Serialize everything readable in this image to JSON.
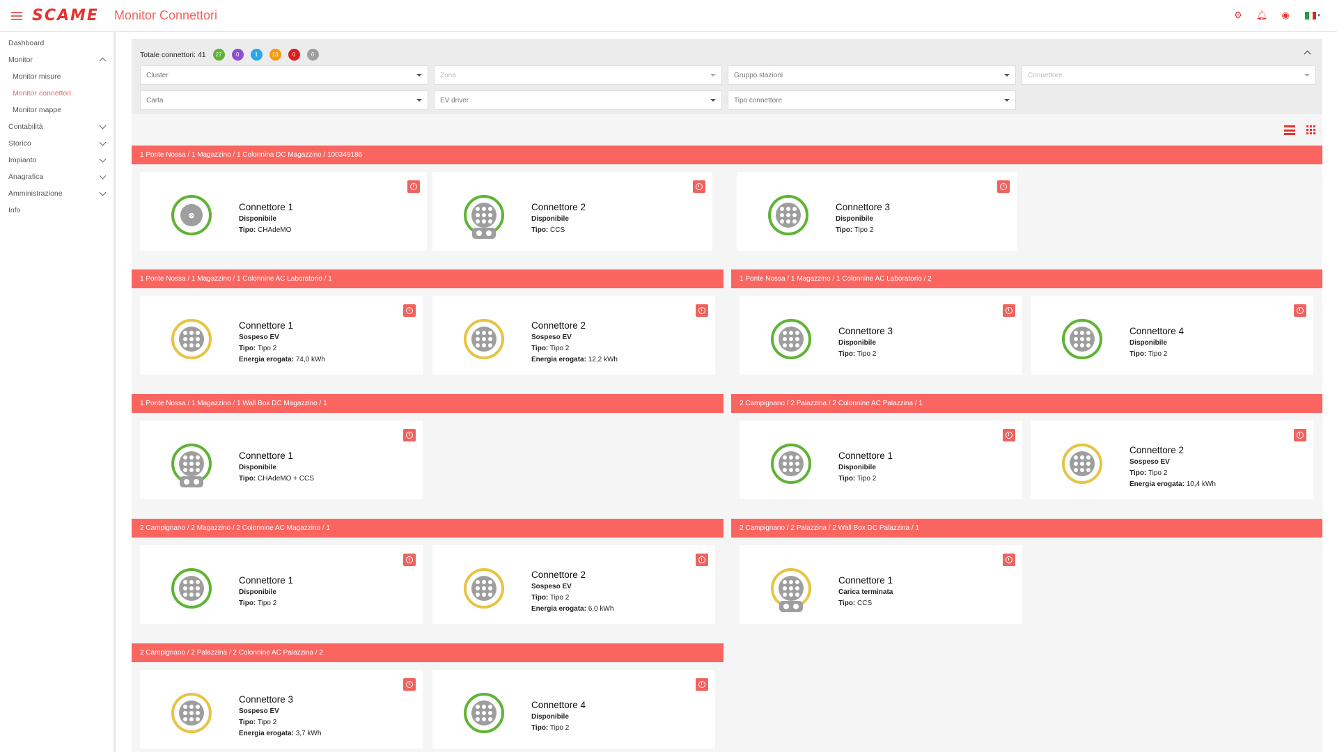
{
  "app": {
    "logo": "SCAME",
    "title": "Monitor Connettori"
  },
  "icons": {
    "settings": "gear-icon",
    "notifications": "bell-icon",
    "account": "user-icon",
    "language": "italy-flag-icon",
    "accent": "#f0625e"
  },
  "sidebar": {
    "items": [
      {
        "label": "Dashboard",
        "type": "item"
      },
      {
        "label": "Monitor",
        "type": "expanded"
      },
      {
        "label": "Monitor misure",
        "type": "sub"
      },
      {
        "label": "Monitor connettori",
        "type": "sub-active"
      },
      {
        "label": "Monitor mappe",
        "type": "sub"
      },
      {
        "label": "Contabilità",
        "type": "collapsed"
      },
      {
        "label": "Storico",
        "type": "collapsed"
      },
      {
        "label": "Impianto",
        "type": "collapsed"
      },
      {
        "label": "Anagrafica",
        "type": "collapsed"
      },
      {
        "label": "Amministrazione",
        "type": "collapsed"
      },
      {
        "label": "Info",
        "type": "item"
      }
    ]
  },
  "filters": {
    "total_label": "Totale connettori: 41",
    "badges": [
      {
        "value": "27",
        "color": "#5fb336"
      },
      {
        "value": "0",
        "color": "#8b4fd1"
      },
      {
        "value": "1",
        "color": "#28a7e8"
      },
      {
        "value": "13",
        "color": "#f39c12"
      },
      {
        "value": "0",
        "color": "#d81e1e"
      },
      {
        "value": "0",
        "color": "#9e9e9e"
      }
    ],
    "cluster": "Cluster",
    "zona": "Zona",
    "gruppo": "Gruppo stazioni",
    "connettore": "Connettore",
    "carta": "Carta",
    "ev_driver": "EV driver",
    "tipo": "Tipo connettore"
  },
  "groups": [
    {
      "title": "1 Ponte Nossa / 1 Magazzino / 1 Colonnina DC Magazzino / 100349186",
      "connectors": [
        {
          "name": "Connettore 1",
          "status": "Disponibile",
          "color": "green",
          "plug": "chademo",
          "tipo": "CHAdeMO"
        },
        {
          "name": "Connettore 2",
          "status": "Disponibile",
          "color": "green",
          "plug": "ccs",
          "tipo": "CCS"
        },
        {
          "name": "Connettore 3",
          "status": "Disponibile",
          "color": "green",
          "plug": "t2",
          "tipo": "Tipo 2"
        }
      ]
    },
    {
      "title": "1 Ponte Nossa / 1 Magazzino / 1 Colonnine AC Laboratorio / 1",
      "connectors": [
        {
          "name": "Connettore 1",
          "status": "Sospeso EV",
          "color": "yellow",
          "plug": "t2",
          "tipo": "Tipo 2",
          "energia": "74,0 kWh"
        },
        {
          "name": "Connettore 2",
          "status": "Sospeso EV",
          "color": "yellow",
          "plug": "t2",
          "tipo": "Tipo 2",
          "energia": "12,2 kWh"
        }
      ]
    },
    {
      "title": "1 Ponte Nossa / 1 Magazzino / 1 Colonnine AC Laboratorio / 2",
      "connectors": [
        {
          "name": "Connettore 3",
          "status": "Disponibile",
          "color": "green",
          "plug": "t2",
          "tipo": "Tipo 2"
        },
        {
          "name": "Connettore 4",
          "status": "Disponibile",
          "color": "green",
          "plug": "t2",
          "tipo": "Tipo 2"
        }
      ]
    },
    {
      "title": "1 Ponte Nossa / 1 Magazzino / 1 Wall Box DC Magazzino / 1",
      "connectors": [
        {
          "name": "Connettore 1",
          "status": "Disponibile",
          "color": "green",
          "plug": "ccs",
          "tipo": "CHAdeMO + CCS"
        }
      ]
    },
    {
      "title": "2 Campignano / 2 Palazzina / 2 Colonnine AC Palazzina / 1",
      "connectors": [
        {
          "name": "Connettore 1",
          "status": "Disponibile",
          "color": "green",
          "plug": "t2",
          "tipo": "Tipo 2"
        },
        {
          "name": "Connettore 2",
          "status": "Sospeso EV",
          "color": "yellow",
          "plug": "t2",
          "tipo": "Tipo 2",
          "energia": "10,4 kWh"
        }
      ]
    },
    {
      "title": "2 Campignano / 2 Magazzino / 2 Colonnine AC Magazzino / 1",
      "connectors": [
        {
          "name": "Connettore 1",
          "status": "Disponibile",
          "color": "green",
          "plug": "t2",
          "tipo": "Tipo 2"
        },
        {
          "name": "Connettore 2",
          "status": "Sospeso EV",
          "color": "yellow",
          "plug": "t2",
          "tipo": "Tipo 2",
          "energia": "6,0 kWh"
        }
      ]
    },
    {
      "title": "2 Campignano / 2 Palazzina / 2 Wall Box DC Palazzina / 1",
      "connectors": [
        {
          "name": "Connettore 1",
          "status": "Carica terminata",
          "color": "yellow",
          "plug": "ccs",
          "tipo": "CCS"
        }
      ]
    },
    {
      "title": "2 Campignano / 2 Palazzina / 2 Colonnine AC Palazzina / 2",
      "connectors": [
        {
          "name": "Connettore 3",
          "status": "Sospeso EV",
          "color": "yellow",
          "plug": "t2",
          "tipo": "Tipo 2",
          "energia": "3,7 kWh"
        },
        {
          "name": "Connettore 4",
          "status": "Disponibile",
          "color": "green",
          "plug": "t2",
          "tipo": "Tipo 2"
        }
      ]
    }
  ],
  "labels": {
    "tipo": "Tipo:",
    "energia": "Energia erogata:"
  }
}
